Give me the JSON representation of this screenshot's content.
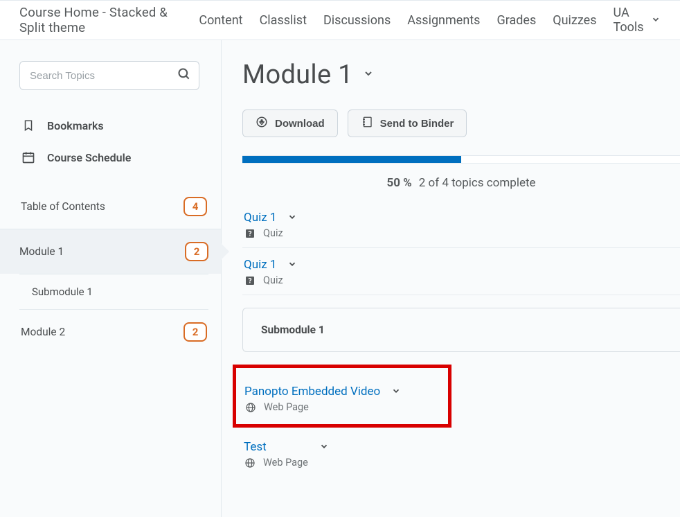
{
  "nav": {
    "course_title": "Course Home - Stacked & Split theme",
    "items": [
      "Content",
      "Classlist",
      "Discussions",
      "Assignments",
      "Grades",
      "Quizzes",
      "UA Tools"
    ]
  },
  "sidebar": {
    "search_placeholder": "Search Topics",
    "bookmarks": "Bookmarks",
    "schedule": "Course Schedule",
    "toc": [
      {
        "label": "Table of Contents",
        "count": "4"
      },
      {
        "label": "Module 1",
        "count": "2"
      },
      {
        "label": "Submodule 1"
      },
      {
        "label": "Module 2",
        "count": "2"
      }
    ]
  },
  "main": {
    "title": "Module 1",
    "download": "Download",
    "binder": "Send to Binder",
    "progress": {
      "pct_value": 50,
      "pct_label": "50 %",
      "text": "2 of 4 topics complete"
    },
    "items": [
      {
        "title": "Quiz 1",
        "type_label": "Quiz",
        "icon": "quiz"
      },
      {
        "title": "Quiz 1",
        "type_label": "Quiz",
        "icon": "quiz"
      }
    ],
    "submodule_title": "Submodule 1",
    "highlighted": {
      "title": "Panopto Embedded Video",
      "type_label": "Web Page",
      "icon": "web"
    },
    "after": {
      "title": "Test",
      "type_label": "Web Page",
      "icon": "web"
    }
  }
}
